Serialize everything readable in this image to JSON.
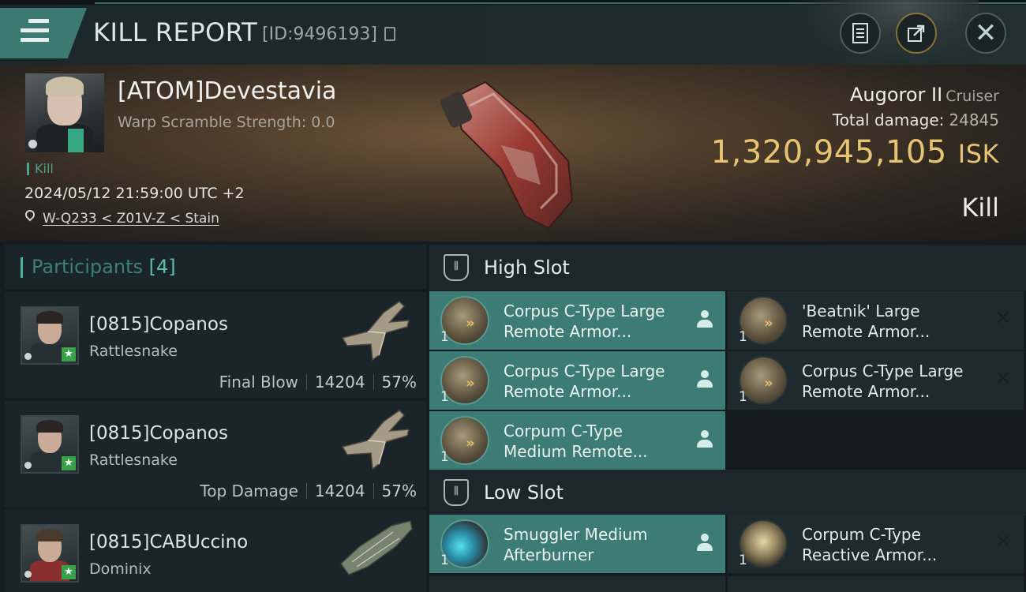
{
  "header": {
    "title": "KILL REPORT",
    "id_label": "[ID:9496193]",
    "icons": [
      "menu-icon",
      "copy-icon",
      "clipboard-icon",
      "share-icon",
      "close-icon"
    ]
  },
  "victim": {
    "name": "[ATOM]Devestavia",
    "warp_scramble": "Warp Scramble Strength: 0.0",
    "tag": "Kill",
    "date": "2024/05/12 21:59:00 UTC +2",
    "location": "W-Q233 < Z01V-Z < Stain",
    "ship": "Augoror II",
    "ship_class": "Cruiser",
    "total_damage_label": "Total damage:",
    "total_damage": "24845",
    "isk_value": "1,320,945,105",
    "isk_unit": "ISK",
    "result": "Kill"
  },
  "participants": {
    "label": "Participants",
    "count": "[4]",
    "rows": [
      {
        "name": "[0815]Copanos",
        "ship": "Rattlesnake",
        "role": "Final Blow",
        "damage": "14204",
        "percent": "57%"
      },
      {
        "name": "[0815]Copanos",
        "ship": "Rattlesnake",
        "role": "Top Damage",
        "damage": "14204",
        "percent": "57%"
      },
      {
        "name": "[0815]CABUccino",
        "ship": "Dominix",
        "role": "",
        "damage": "",
        "percent": ""
      }
    ]
  },
  "fitting": {
    "high_slot": {
      "title": "High Slot",
      "modules": [
        {
          "name_line1": "Corpus C-Type Large",
          "name_line2": "Remote Armor...",
          "qty": "1",
          "active": true
        },
        {
          "name_line1": "'Beatnik' Large",
          "name_line2": "Remote Armor...",
          "qty": "1",
          "active": false
        },
        {
          "name_line1": "Corpus C-Type Large",
          "name_line2": "Remote Armor...",
          "qty": "1",
          "active": true
        },
        {
          "name_line1": "Corpus C-Type Large",
          "name_line2": "Remote Armor...",
          "qty": "1",
          "active": false
        },
        {
          "name_line1": "Corpum C-Type",
          "name_line2": "Medium Remote...",
          "qty": "1",
          "active": true
        }
      ]
    },
    "low_slot": {
      "title": "Low Slot",
      "modules": [
        {
          "name_line1": "Smuggler Medium",
          "name_line2": "Afterburner",
          "qty": "1",
          "active": true
        },
        {
          "name_line1": "Corpum C-Type",
          "name_line2": "Reactive Armor...",
          "qty": "1",
          "active": false
        }
      ]
    }
  },
  "colors": {
    "accent": "#3d7c74",
    "isk": "#e7c472",
    "background": "#141c20"
  }
}
